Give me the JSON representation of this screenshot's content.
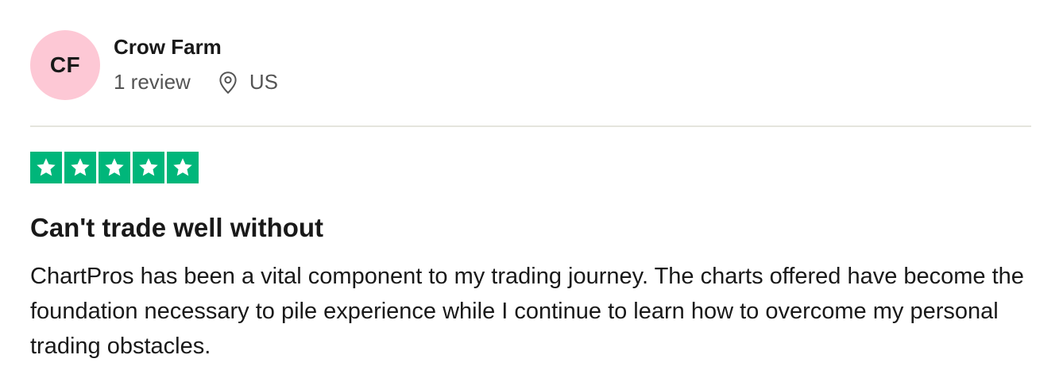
{
  "reviewer": {
    "initials": "CF",
    "name": "Crow Farm",
    "review_count": "1 review",
    "country": "US",
    "avatar_color": "#fdc8d5"
  },
  "rating": {
    "stars": 5,
    "max_stars": 5,
    "color": "#00b67a",
    "icon": "star-icon"
  },
  "review": {
    "title": "Can't trade well without",
    "body": "ChartPros has been a vital component to my trading journey. The charts offered have become the foundation necessary to pile experience while I continue to learn how to overcome my personal trading obstacles."
  },
  "icons": {
    "location": "location-pin-icon"
  }
}
